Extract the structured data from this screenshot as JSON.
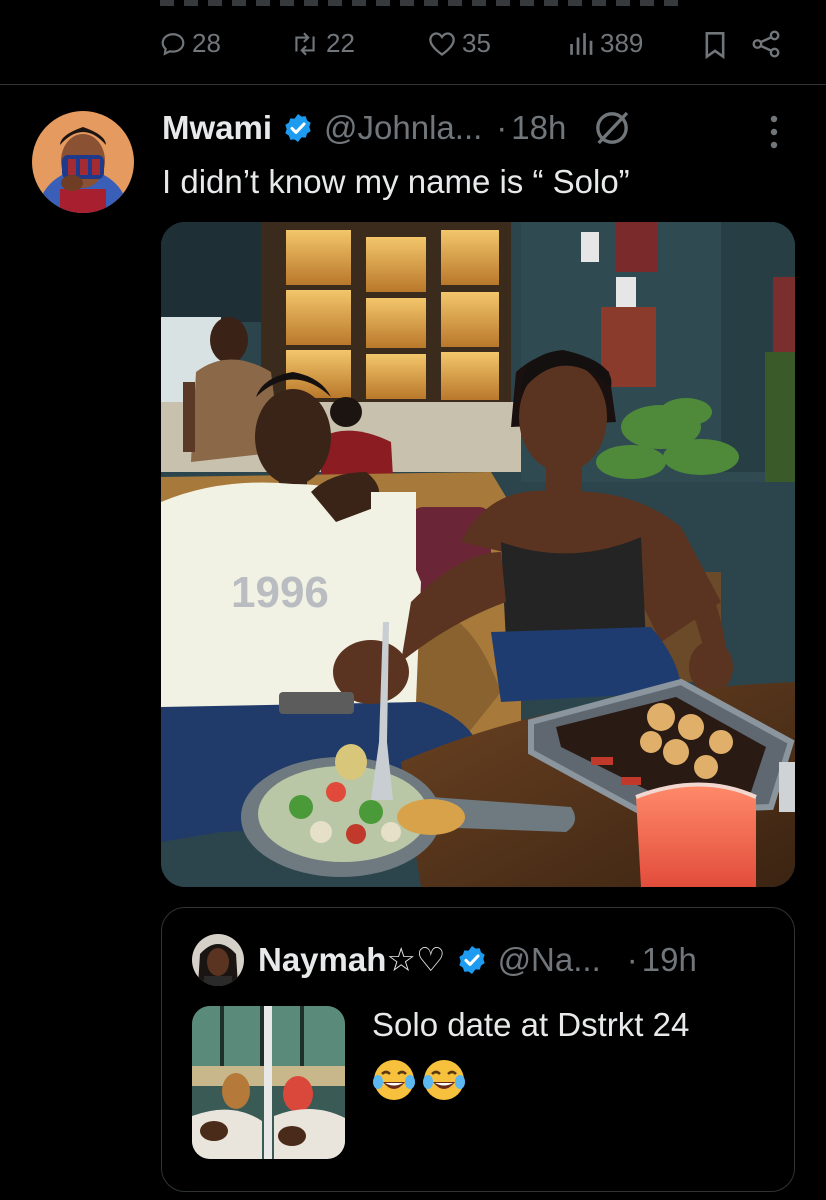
{
  "prev_tweet": {
    "actions": {
      "replies": "28",
      "reposts": "22",
      "likes": "35",
      "views": "389"
    }
  },
  "tweet": {
    "author_name": "Mwami",
    "handle": "@Johnla...",
    "separator": "·",
    "time": "18h",
    "text": "I didn’t know my name is “ Solo”",
    "verified_color": "#1d9bf0"
  },
  "quote": {
    "author_name": "Naymah☆♡",
    "handle": "@Na...",
    "separator": "·",
    "time": "19h",
    "text": "Solo date at Dstrkt 24",
    "emoji": "😂😂"
  },
  "photo": {
    "shirt_print": "1996"
  },
  "colors": {
    "background": "#000000",
    "text_primary": "#e7e9ea",
    "text_secondary": "#71767b",
    "accent": "#1d9bf0",
    "border": "#2f3336"
  }
}
